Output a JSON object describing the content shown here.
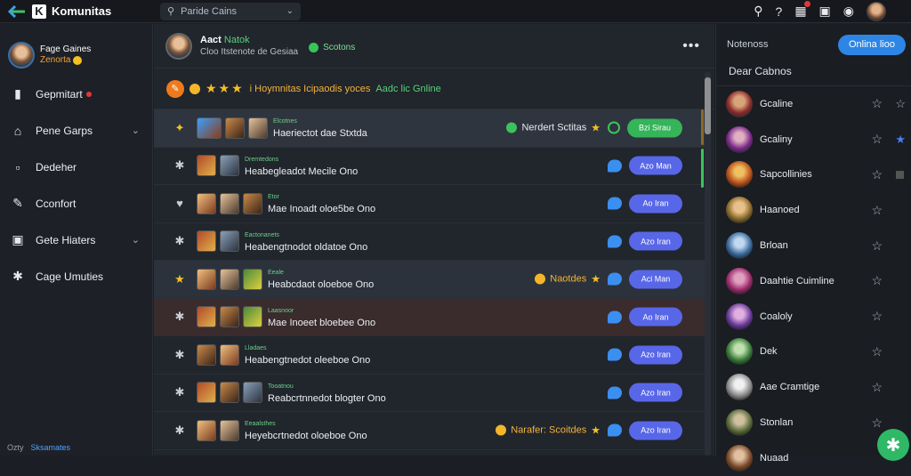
{
  "app": {
    "name": "Komunitas"
  },
  "search": {
    "text": "Paride Cains"
  },
  "sidebar": {
    "user_name": "Fage Gaines",
    "user_status": "Zenorta",
    "items": [
      {
        "label": "Gepmitart",
        "icon": "bookmark-icon",
        "badge": true
      },
      {
        "label": "Pene Garps",
        "icon": "home-icon",
        "chevron": true
      },
      {
        "label": "Dedeher",
        "icon": "document-icon"
      },
      {
        "label": "Cconfort",
        "icon": "edit-icon"
      },
      {
        "label": "Gete Hiaters",
        "icon": "gamepad-icon",
        "chevron": true
      },
      {
        "label": "Cage Umuties",
        "icon": "community-icon"
      }
    ],
    "footer": {
      "left": "Ozty",
      "right": "Sksamates"
    }
  },
  "main": {
    "title": "Aact",
    "title_hl": "Natok",
    "subtitle": "Cloo Itstenote de Gesiaa",
    "status": "Scotons",
    "banner": {
      "text": "i Hoymnitas Icipaodis yoces",
      "online": "Aadc lic Gnline"
    },
    "rows": [
      {
        "star": "gold-burst",
        "tag": "Elcotnes",
        "text": "Haeriectot dae Stxtda",
        "extra": "Nerdert Sctitas",
        "button": "Bzi Sirau",
        "ring": true,
        "hl": "first"
      },
      {
        "star": "gear",
        "tag": "Dremtedons",
        "text": "Heabegleadot Mecile Ono",
        "button": "Azo Man"
      },
      {
        "star": "heart",
        "tag": "Etor",
        "text": "Mae Inoadt oloe5be Ono",
        "button": "Ao Iran"
      },
      {
        "star": "gear",
        "tag": "Eactonanets",
        "text": "Heabengtnodot oldatoe Ono",
        "button": "Azo Iran"
      },
      {
        "star": "gold",
        "tag": "Eeale",
        "text": "Heabcdaot oloeboe Ono",
        "extra": "Naotdes",
        "button": "Aci Man",
        "hl": "hl"
      },
      {
        "star": "gear",
        "tag": "Laasnoor",
        "text": "Mae Inoeet bloebee Ono",
        "button": "Ao Iran",
        "hl": "red"
      },
      {
        "star": "gear",
        "tag": "Lladaes",
        "text": "Heabengtnedot oleeboe Ono",
        "button": "Azo Iran"
      },
      {
        "star": "gear",
        "tag": "Tooatnou",
        "text": "Reabcrtnnedot blogter Ono",
        "button": "Azo Iran"
      },
      {
        "star": "gear",
        "tag": "Eeaalsthes",
        "text": "Heyebcrtnedot oloeboe Ono",
        "extra": "Narafer: Scoitdes",
        "button": "Azo Iran"
      }
    ]
  },
  "right": {
    "title": "Notenoss",
    "online_btn": "Onlina lioo",
    "sub": "Dear Cabnos",
    "people": [
      "Gcaline",
      "Gcaliny",
      "Sapcollinies",
      "Haanoed",
      "Brloan",
      "Daahtie Cuimline",
      "Coaloly",
      "Dek",
      "Aae Cramtige",
      "Stonlan",
      "Nuaad"
    ]
  }
}
